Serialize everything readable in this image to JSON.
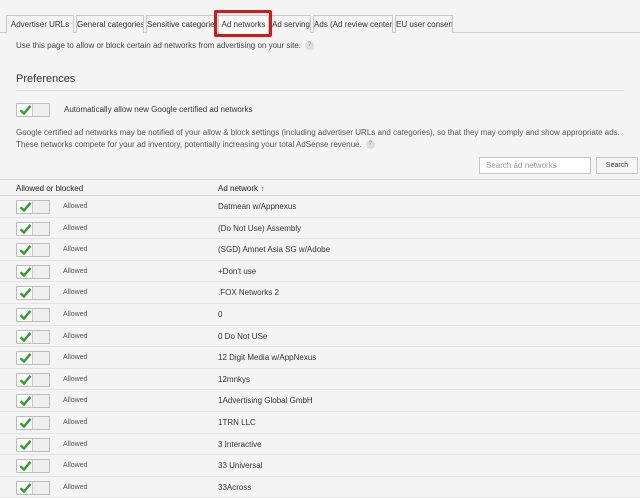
{
  "tabs": [
    {
      "label": "Advertiser URLs"
    },
    {
      "label": "General categories"
    },
    {
      "label": "Sensitive categories"
    },
    {
      "label": "Ad networks"
    },
    {
      "label": "Ad serving"
    },
    {
      "label": "Ads (Ad review center)"
    },
    {
      "label": "EU user consent"
    }
  ],
  "active_tab": "Ad networks",
  "intro": "Use this page to allow or block certain ad networks from advertising on your site.",
  "preferences": {
    "title": "Preferences",
    "auto_allow_label": "Automatically allow new Google certified ad networks",
    "description_line1": "Google certified ad networks may be notified of your allow & block settings (including advertiser URLs and categories), so that they may comply and show appropriate ads.",
    "description_line2": "These networks compete for your ad inventory, potentially increasing your total AdSense revenue."
  },
  "search": {
    "placeholder": "Search ad networks",
    "button_label": "Search"
  },
  "table": {
    "headers": {
      "status": "Allowed or blocked",
      "network": "Ad network"
    },
    "sort_indicator": "↑",
    "rows": [
      {
        "status": "Allowed",
        "network": "Datmean w/Appnexus"
      },
      {
        "status": "Allowed",
        "network": "(Do Not Use) Assembly"
      },
      {
        "status": "Allowed",
        "network": "(SGD) Amnet Asia SG w/Adobe"
      },
      {
        "status": "Allowed",
        "network": "+Don't use"
      },
      {
        "status": "Allowed",
        "network": ".FOX Networks 2"
      },
      {
        "status": "Allowed",
        "network": "0"
      },
      {
        "status": "Allowed",
        "network": "0 Do Not USe"
      },
      {
        "status": "Allowed",
        "network": "12 Digit Media w/AppNexus"
      },
      {
        "status": "Allowed",
        "network": "12mnkys"
      },
      {
        "status": "Allowed",
        "network": "1Advertising Global GmbH"
      },
      {
        "status": "Allowed",
        "network": "1TRN LLC"
      },
      {
        "status": "Allowed",
        "network": "3 Interactive"
      },
      {
        "status": "Allowed",
        "network": "33 Universal"
      },
      {
        "status": "Allowed",
        "network": "33Across"
      }
    ]
  },
  "colors": {
    "check": "#2e9e2e",
    "highlight": "#d11b1b"
  },
  "icons": {
    "toggle_on": "checkmark-icon",
    "help": "help-icon",
    "sort": "sort-ascending-icon"
  }
}
